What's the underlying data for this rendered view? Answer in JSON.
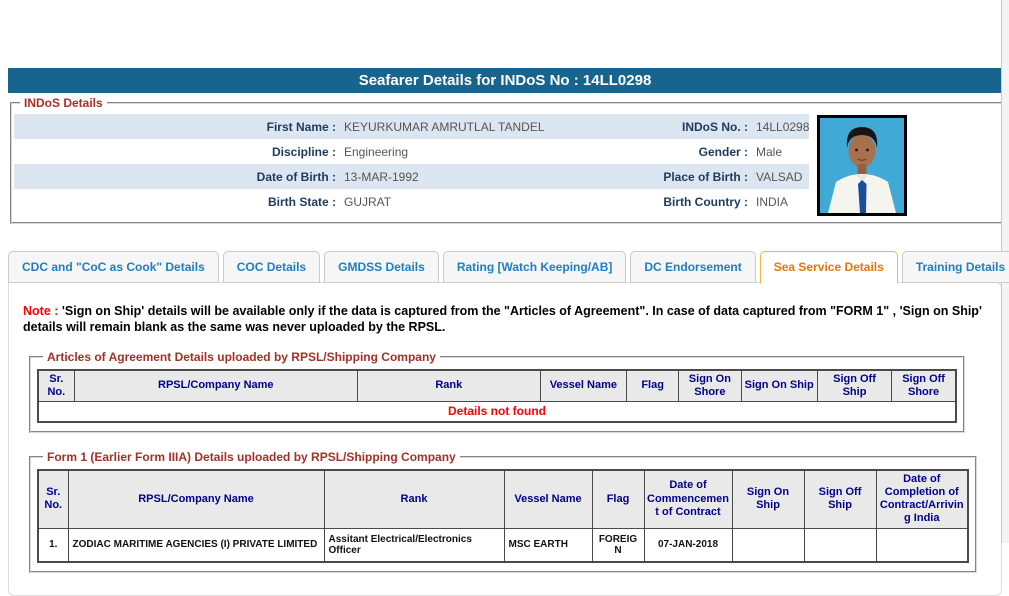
{
  "header": {
    "title": "Seafarer Details for INDoS No : 14LL0298"
  },
  "colors": {
    "title_bar": "#17648F",
    "legend_red": "#A13226",
    "table_header_navy": "#00008B",
    "tab_text_blue": "#1F7EC2",
    "active_tab_text": "#E8750E",
    "active_tab_border": "#F9B938",
    "note_red": "#FF0000",
    "stripe_row": "#DCE6F1",
    "photo_background": "#41A9D6"
  },
  "indos": {
    "legend": "INDoS Details",
    "rows": [
      {
        "label1": "First Name :",
        "value1": "KEYURKUMAR AMRUTLAL TANDEL",
        "label2": "INDoS No. :",
        "value2": "14LL0298"
      },
      {
        "label1": "Discipline :",
        "value1": "Engineering",
        "label2": "Gender :",
        "value2": "Male"
      },
      {
        "label1": "Date of Birth :",
        "value1": "13-MAR-1992",
        "label2": "Place of Birth :",
        "value2": "VALSAD"
      },
      {
        "label1": "Birth State :",
        "value1": "GUJRAT",
        "label2": "Birth Country :",
        "value2": "INDIA"
      }
    ],
    "photo_alt": "seafarer-photo"
  },
  "tabs": {
    "items": [
      {
        "label": "CDC and \"CoC as Cook\" Details",
        "active": false
      },
      {
        "label": "COC Details",
        "active": false
      },
      {
        "label": "GMDSS Details",
        "active": false
      },
      {
        "label": "Rating [Watch Keeping/AB]",
        "active": false
      },
      {
        "label": "DC Endorsement",
        "active": false
      },
      {
        "label": "Sea Service Details",
        "active": true
      },
      {
        "label": "Training Details",
        "active": false
      }
    ]
  },
  "note": {
    "label": "Note :",
    "text": "'Sign on Ship' details will be available only if the data is captured from the \"Articles of Agreement\". In case of data captured from \"FORM 1\" , 'Sign on Ship' details will remain blank as the same was never uploaded by the RPSL."
  },
  "aoa_table": {
    "legend": "Articles of Agreement Details uploaded by RPSL/Shipping Company",
    "headers": [
      "Sr. No.",
      "RPSL/Company Name",
      "Rank",
      "Vessel Name",
      "Flag",
      "Sign On Shore",
      "Sign On Ship",
      "Sign Off Ship",
      "Sign Off Shore"
    ],
    "empty_message": "Details not found"
  },
  "form1_table": {
    "legend": "Form 1 (Earlier Form IIIA) Details uploaded by RPSL/Shipping Company",
    "headers": [
      "Sr. No.",
      "RPSL/Company Name",
      "Rank",
      "Vessel Name",
      "Flag",
      "Date of Commencement of Contract",
      "Sign On Ship",
      "Sign Off Ship",
      "Date of Completion of Contract/Arriving India"
    ],
    "rows": [
      {
        "cells": [
          "1.",
          "ZODIAC MARITIME AGENCIES (I) PRIVATE LIMITED",
          "Assitant Electrical/Electronics Officer",
          "MSC EARTH",
          "FOREIGN",
          "07-JAN-2018",
          "",
          "",
          ""
        ]
      }
    ]
  }
}
